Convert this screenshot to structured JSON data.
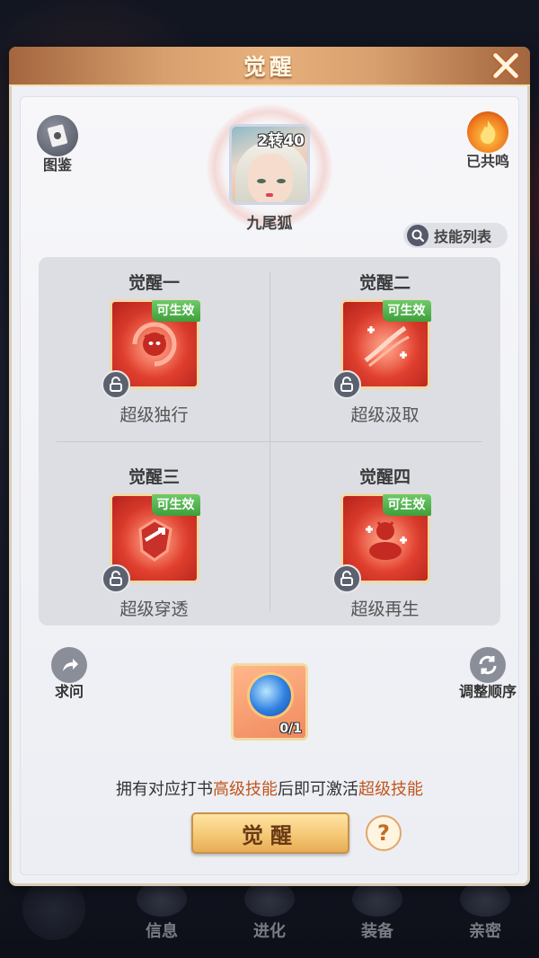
{
  "dialog": {
    "title": "觉醒",
    "close_icon": "close-icon"
  },
  "atlas": {
    "label": "图鉴",
    "icon": "book-icon"
  },
  "resonance": {
    "label": "已共鸣",
    "icon": "flame-icon"
  },
  "pet": {
    "name": "九尾狐",
    "level_text": "2转40"
  },
  "skill_list_button": {
    "label": "技能列表",
    "icon": "search-icon"
  },
  "awakenings": [
    {
      "title": "觉醒一",
      "badge": "可生效",
      "skill": "超级独行",
      "icon": "demon-sprite-icon"
    },
    {
      "title": "觉醒二",
      "badge": "可生效",
      "skill": "超级汲取",
      "icon": "drain-slash-icon"
    },
    {
      "title": "觉醒三",
      "badge": "可生效",
      "skill": "超级穿透",
      "icon": "pierce-shield-icon"
    },
    {
      "title": "觉醒四",
      "badge": "可生效",
      "skill": "超级再生",
      "icon": "regen-meditate-icon"
    }
  ],
  "ask_button": {
    "label": "求问",
    "icon": "share-arrow-icon"
  },
  "reorder_button": {
    "label": "调整顺序",
    "icon": "refresh-icon"
  },
  "item": {
    "count_text": "0/1",
    "icon": "swirl-orb-icon"
  },
  "hint": {
    "part1": "拥有对应打书",
    "highlight1": "高级技能",
    "part2": "后即可激活",
    "highlight2": "超级技能"
  },
  "awaken_button": {
    "label": "觉醒"
  },
  "help_button": {
    "label": "?"
  },
  "bottom_tabs": [
    {
      "label": ""
    },
    {
      "label": "信息"
    },
    {
      "label": "进化"
    },
    {
      "label": "装备"
    },
    {
      "label": "亲密"
    }
  ],
  "colors": {
    "header": "#d8a06e",
    "badge_green": "#4fae4a",
    "highlight_orange": "#c0561d",
    "button_gold": "#f5c876"
  }
}
